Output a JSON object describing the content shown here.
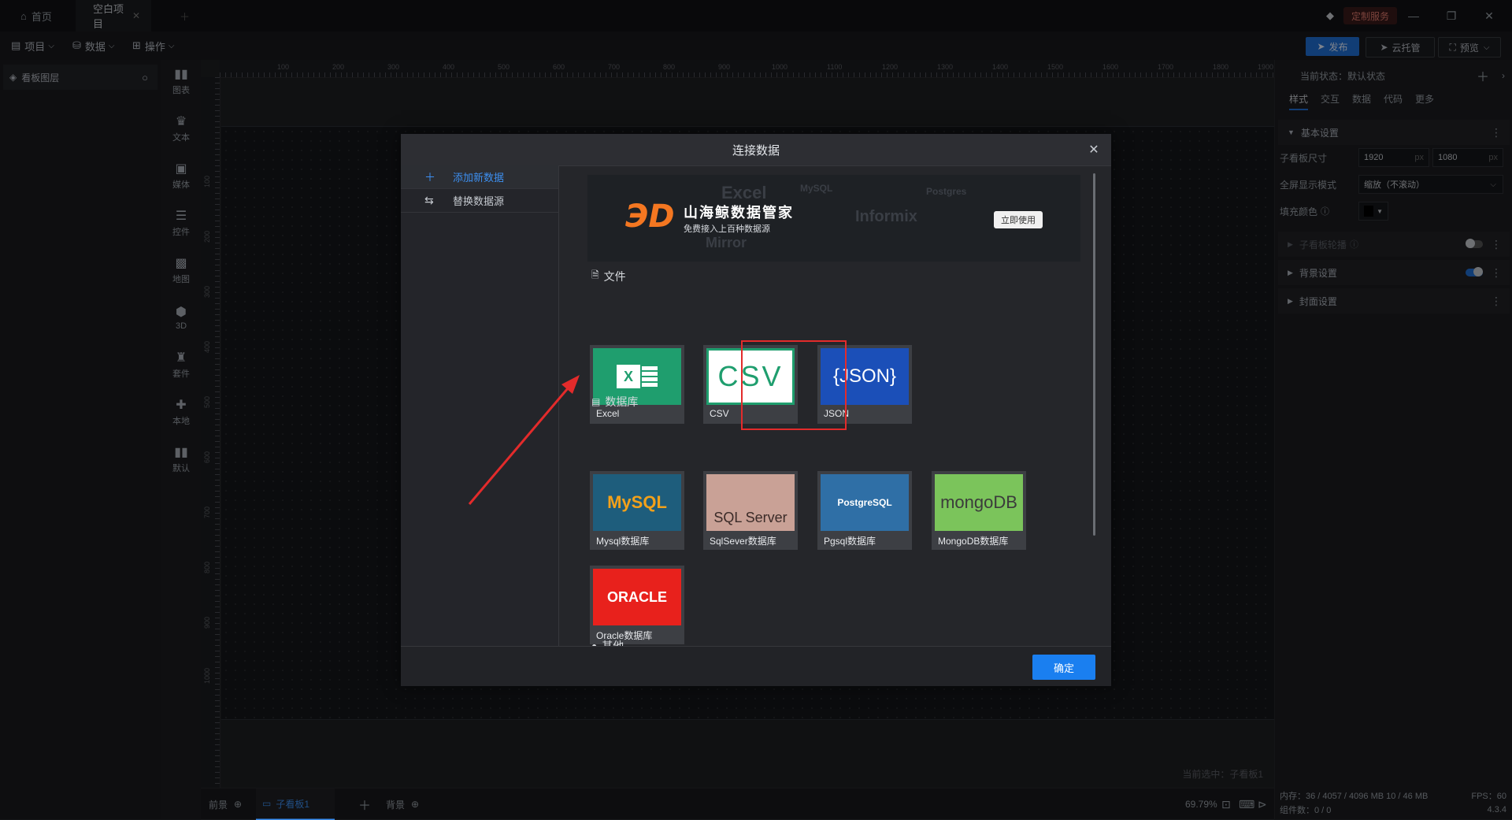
{
  "topbar": {
    "home_tab": "首页",
    "project_tab": "空白项目",
    "custom_service": "定制服务"
  },
  "menubar": {
    "project": "项目",
    "data": "数据",
    "operate": "操作",
    "publish": "发布",
    "cloud": "云托管",
    "preview": "预览"
  },
  "layers": {
    "title": "看板图层"
  },
  "rail": [
    "图表",
    "文本",
    "媒体",
    "控件",
    "地图",
    "3D",
    "套件",
    "本地",
    "默认"
  ],
  "ruler": {
    "top": [
      "100",
      "200",
      "300",
      "400",
      "500",
      "600",
      "700",
      "800",
      "900",
      "1000",
      "1100",
      "1200",
      "1300",
      "1400",
      "1500",
      "1600",
      "1700",
      "1800",
      "1900"
    ],
    "left": [
      "100",
      "200",
      "300",
      "400",
      "500",
      "600",
      "700",
      "800",
      "900",
      "1000"
    ]
  },
  "canvas": {
    "current_selected": "当前选中：子看板1"
  },
  "bottombar": {
    "front": "前景",
    "board_tab": "子看板1",
    "back": "背景",
    "zoom": "69.79%"
  },
  "rpanel": {
    "state_label": "当前状态：默认状态",
    "tabs": [
      "样式",
      "交互",
      "数据",
      "代码",
      "更多"
    ],
    "basic": "基本设置",
    "size_label": "子看板尺寸",
    "width": "1920",
    "height": "1080",
    "unit": "px",
    "fullscreen_label": "全屏显示模式",
    "fullscreen_value": "缩放（不滚动）",
    "fill_label": "填充颜色",
    "carousel": "子看板轮播",
    "background": "背景设置",
    "cover": "封面设置",
    "mem": "内存：36 / 4057 / 4096 MB  10 / 46 MB",
    "fps": "FPS：60",
    "components": "组件数：0 / 0",
    "version": "4.3.4"
  },
  "modal": {
    "title": "连接数据",
    "side_add": "添加新数据",
    "side_replace": "替换数据源",
    "banner_title": "山海鲸数据管家",
    "banner_sub": "免费接入上百种数据源",
    "banner_btn": "立即使用",
    "banner_logo": "ЭD",
    "banner_deco": [
      "Excel",
      "Informix",
      "Mirror",
      "MySQL",
      "Postgres"
    ],
    "section_file": "文件",
    "section_db": "数据库",
    "section_other": "其他",
    "files": [
      {
        "art": "X",
        "label": "Excel"
      },
      {
        "art": "CSV",
        "label": "CSV"
      },
      {
        "art": "{JSON}",
        "label": "JSON"
      }
    ],
    "databases": [
      {
        "art": "MySQL",
        "label": "Mysql数据库"
      },
      {
        "art": "SQL Server",
        "label": "SqlSever数据库"
      },
      {
        "art": "PostgreSQL",
        "label": "Pgsql数据库"
      },
      {
        "art": "mongoDB",
        "label": "MongoDB数据库"
      },
      {
        "art": "ORACLE",
        "label": "Oracle数据库"
      }
    ],
    "ok": "确定"
  },
  "colors": {
    "accent": "#1a7ff0",
    "excel": "#1f9e6e",
    "csv": "#1f9e6e",
    "json": "#1b4fb8",
    "mysql": "#1e5d7c",
    "sqlserver": "#c9a196",
    "postgres": "#2f6fa6",
    "mongo": "#7bc45b",
    "oracle": "#e8211c",
    "highlight": "#e32b2b"
  }
}
